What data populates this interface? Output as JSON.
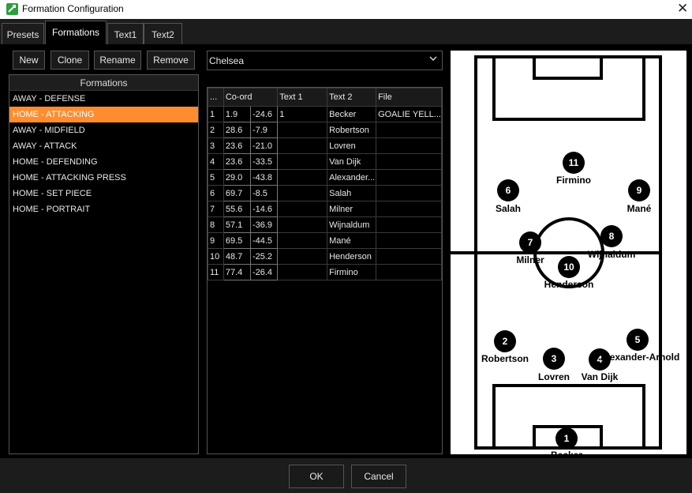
{
  "window": {
    "title": "Formation Configuration",
    "close_glyph": "✕"
  },
  "tabs": [
    "Presets",
    "Formations",
    "Text1",
    "Text2"
  ],
  "active_tab": "Formations",
  "toolbar": {
    "new": "New",
    "clone": "Clone",
    "rename": "Rename",
    "remove": "Remove"
  },
  "formations": {
    "header": "Formations",
    "items": [
      "AWAY - DEFENSE",
      "HOME - ATTACKING",
      "AWAY - MIDFIELD",
      "AWAY - ATTACK",
      "HOME - DEFENDING",
      "HOME - ATTACKING PRESS",
      "HOME - SET PIECE",
      "HOME - PORTRAIT"
    ],
    "selected": "HOME - ATTACKING"
  },
  "team_select": {
    "value": "Chelsea"
  },
  "grid": {
    "columns": [
      "...",
      "Co-ord",
      "Text 1",
      "Text 2",
      "File"
    ],
    "rows": [
      {
        "n": "1",
        "x": "1.9",
        "y": "-24.6",
        "text1": "1",
        "text2": "Becker",
        "file": "GOALIE YELL..."
      },
      {
        "n": "2",
        "x": "28.6",
        "y": "-7.9",
        "text1": "",
        "text2": "Robertson",
        "file": ""
      },
      {
        "n": "3",
        "x": "23.6",
        "y": "-21.0",
        "text1": "",
        "text2": "Lovren",
        "file": ""
      },
      {
        "n": "4",
        "x": "23.6",
        "y": "-33.5",
        "text1": "",
        "text2": "Van Dijk",
        "file": ""
      },
      {
        "n": "5",
        "x": "29.0",
        "y": "-43.8",
        "text1": "",
        "text2": "Alexander...",
        "file": ""
      },
      {
        "n": "6",
        "x": "69.7",
        "y": "-8.5",
        "text1": "",
        "text2": "Salah",
        "file": ""
      },
      {
        "n": "7",
        "x": "55.6",
        "y": "-14.6",
        "text1": "",
        "text2": "Milner",
        "file": ""
      },
      {
        "n": "8",
        "x": "57.1",
        "y": "-36.9",
        "text1": "",
        "text2": "Wijnaldum",
        "file": ""
      },
      {
        "n": "9",
        "x": "69.5",
        "y": "-44.5",
        "text1": "",
        "text2": "Mané",
        "file": ""
      },
      {
        "n": "10",
        "x": "48.7",
        "y": "-25.2",
        "text1": "",
        "text2": "Henderson",
        "file": ""
      },
      {
        "n": "11",
        "x": "77.4",
        "y": "-26.4",
        "text1": "",
        "text2": "Firmino",
        "file": ""
      }
    ]
  },
  "pitch": {
    "players": [
      {
        "number": "1",
        "name": "Becker"
      },
      {
        "number": "2",
        "name": "Robertson"
      },
      {
        "number": "3",
        "name": "Lovren"
      },
      {
        "number": "4",
        "name": "Van Dijk"
      },
      {
        "number": "5",
        "name": "Alexander-Arnold"
      },
      {
        "number": "6",
        "name": "Salah"
      },
      {
        "number": "7",
        "name": "Milner"
      },
      {
        "number": "8",
        "name": "Wijnaldum"
      },
      {
        "number": "9",
        "name": "Mané"
      },
      {
        "number": "10",
        "name": "Henderson"
      },
      {
        "number": "11",
        "name": "Firmino"
      }
    ]
  },
  "footer": {
    "ok": "OK",
    "cancel": "Cancel"
  },
  "colors": {
    "accent": "#ff8c2e",
    "background": "#000000",
    "pitch": "#ffffff"
  }
}
